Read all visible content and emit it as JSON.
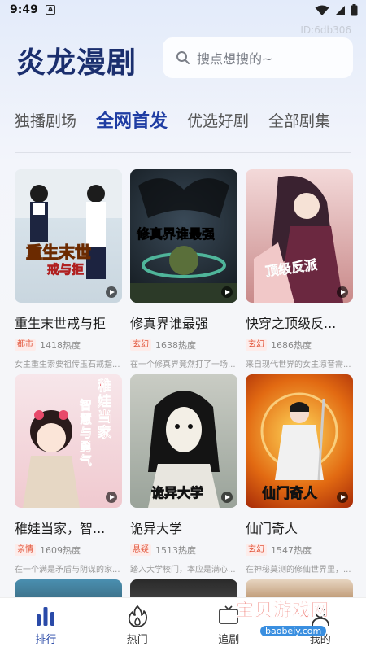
{
  "status": {
    "time": "9:49",
    "notif": "A",
    "device_id": "ID:6db306"
  },
  "header": {
    "app_title": "炎龙漫剧",
    "search_placeholder": "搜点想搜的~"
  },
  "tabs": [
    "独播剧场",
    "全网首发",
    "优选好剧",
    "全部剧集"
  ],
  "active_tab": 1,
  "dramas": [
    {
      "title": "重生末世戒与拒",
      "poster_text": "重生末世",
      "poster_text2": "戒与拒",
      "genre": "都市",
      "heat": "1418热度",
      "desc": "女主重生索要祖传玉石戒指..."
    },
    {
      "title": "修真界谁最强",
      "poster_text": "修真界谁最强",
      "genre": "玄幻",
      "heat": "1638热度",
      "desc": "在一个修真界竟然打了一场..."
    },
    {
      "title": "快穿之顶级反...",
      "poster_text": "顶级反派",
      "genre": "玄幻",
      "heat": "1686热度",
      "desc": "来自现代世界的女主凉音需..."
    },
    {
      "title": "稚娃当家，智...",
      "poster_text": "稚娃当家",
      "poster_text2": "智慧与勇气",
      "genre": "亲情",
      "heat": "1609热度",
      "desc": "在一个满是矛盾与阴谋的家..."
    },
    {
      "title": "诡异大学",
      "poster_text": "诡异大学",
      "genre": "悬疑",
      "heat": "1513热度",
      "desc": "踏入大学校门，本应是满心..."
    },
    {
      "title": "仙门奇人",
      "poster_text": "仙门奇人",
      "genre": "玄幻",
      "heat": "1547热度",
      "desc": "在神秘莫测的修仙世界里，..."
    }
  ],
  "bottom_nav": [
    {
      "label": "排行",
      "icon": "bar-chart-icon"
    },
    {
      "label": "热门",
      "icon": "flame-icon"
    },
    {
      "label": "追剧",
      "icon": "tv-icon"
    },
    {
      "label": "我的",
      "icon": "user-icon"
    }
  ],
  "watermark": {
    "name": "宝贝游戏网",
    "url": "baobeiy.com"
  },
  "colors": {
    "accent": "#1f3da3",
    "title": "#1b2f6e",
    "tag_text": "#e2573d",
    "tag_bg": "#fdecea"
  }
}
